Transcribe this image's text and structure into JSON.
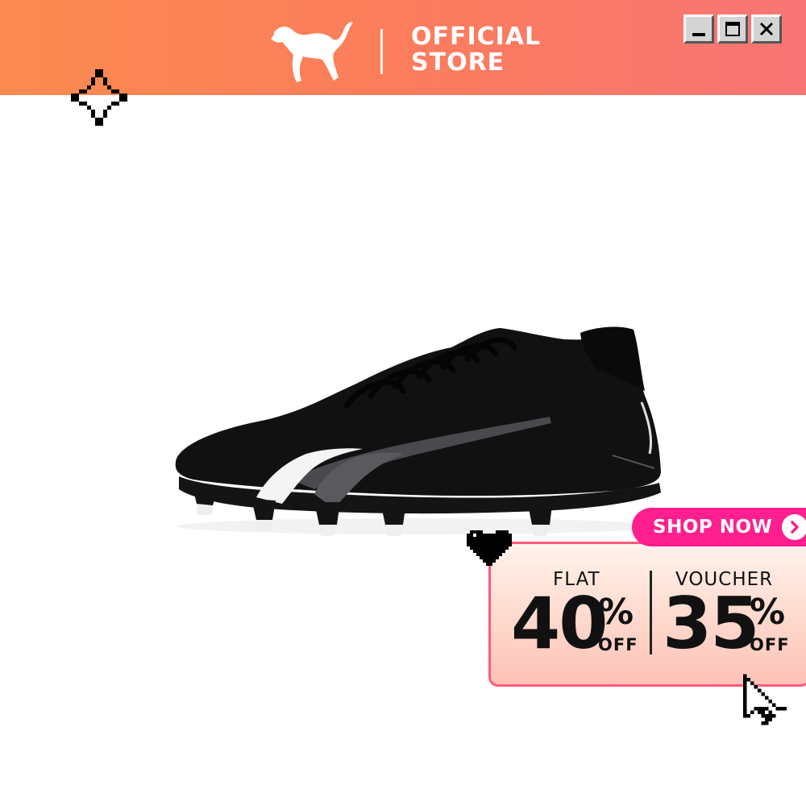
{
  "header": {
    "brand": "PUMA",
    "store_line1": "OFFICIAL",
    "store_line2": "STORE",
    "background_colors": [
      "#fb8a4f",
      "#f87575"
    ]
  },
  "window_controls": {
    "minimize_icon": "minimize-icon",
    "maximize_icon": "maximize-icon",
    "close_icon": "close-icon"
  },
  "product": {
    "image": "black-football-boot",
    "colors": {
      "upper": "#111111",
      "stripe": "#4a4a4e",
      "stud": "#eeeeee"
    }
  },
  "promo": {
    "cta_label": "SHOP NOW",
    "cta_color": "#ff1f8f",
    "deal_1": {
      "label": "FLAT",
      "value": "40",
      "unit": "%",
      "suffix": "OFF"
    },
    "deal_2": {
      "label": "VOUCHER",
      "value": "35",
      "unit": "%",
      "suffix": "OFF"
    }
  },
  "decorations": {
    "sparkle_icon": "sparkle-icon",
    "heart_icon": "heart-icon",
    "cursor_icon": "cursor-icon"
  }
}
